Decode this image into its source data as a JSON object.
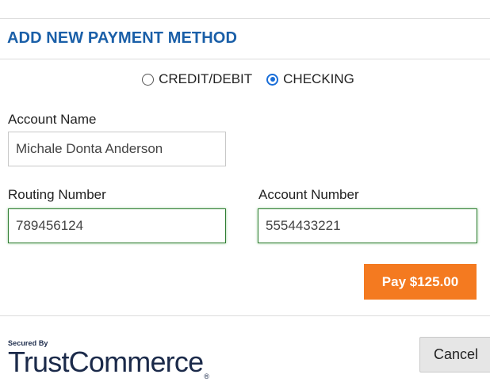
{
  "modal": {
    "title": "ADD NEW PAYMENT METHOD"
  },
  "payment_type": {
    "options": [
      {
        "label": "CREDIT/DEBIT",
        "selected": false
      },
      {
        "label": "CHECKING",
        "selected": true
      }
    ]
  },
  "form": {
    "account_name": {
      "label": "Account Name",
      "value": "Michale Donta Anderson"
    },
    "routing_number": {
      "label": "Routing Number",
      "value": "789456124"
    },
    "account_number": {
      "label": "Account Number",
      "value": "5554433221"
    }
  },
  "actions": {
    "pay_label": "Pay $125.00",
    "cancel_label": "Cancel"
  },
  "footer": {
    "logo_secured": "Secured By",
    "logo_name": "TrustCommerce",
    "logo_mark": "®"
  },
  "colors": {
    "title": "#1a5fa8",
    "radio_selected": "#1a6ed8",
    "pay_button": "#f47a20",
    "valid_border": "#2f7d32",
    "logo": "#1b2a4a"
  }
}
